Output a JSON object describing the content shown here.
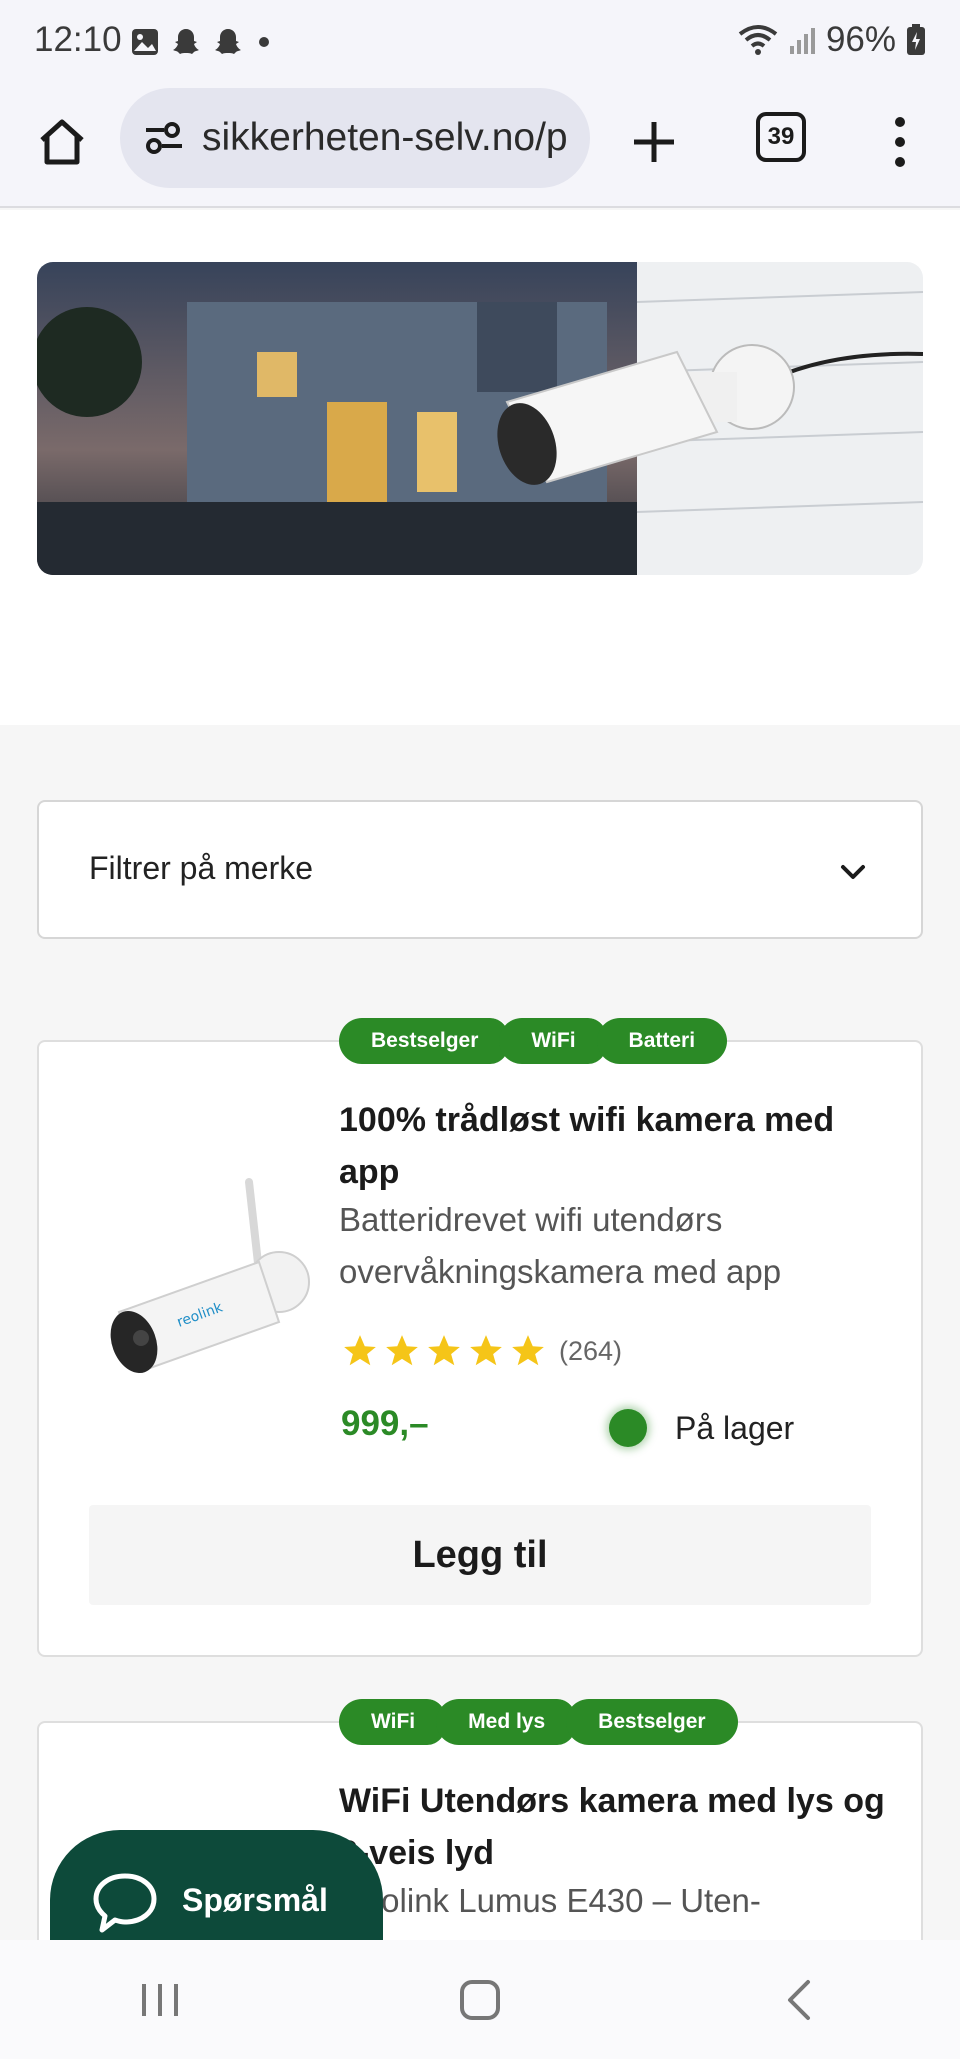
{
  "status_bar": {
    "time": "12:10",
    "battery": "96%"
  },
  "browser": {
    "url": "sikkerheten-selv.no/p",
    "tab_count": "39"
  },
  "filter": {
    "label": "Filtrer på merke"
  },
  "products": [
    {
      "tags": [
        "Bestselger",
        "WiFi",
        "Batteri"
      ],
      "title": "100% trådløst wifi kamera med app",
      "description": "Batteridrevet wifi utendørs overvåkningskamera med app",
      "rating": 5,
      "review_count": "(264)",
      "price": "999,–",
      "stock_status": "På lager",
      "add_label": "Legg til"
    },
    {
      "tags": [
        "WiFi",
        "Med lys",
        "Bestselger"
      ],
      "title": "WiFi Utendørs kamera med lys og 2-veis lyd",
      "description": "Reolink Lumus E430 – Uten-"
    }
  ],
  "chat": {
    "label": "Spørsmål"
  },
  "colors": {
    "accent_green": "#2b8a26",
    "chat_bg": "#0d4a3a",
    "star": "#f5c518"
  }
}
